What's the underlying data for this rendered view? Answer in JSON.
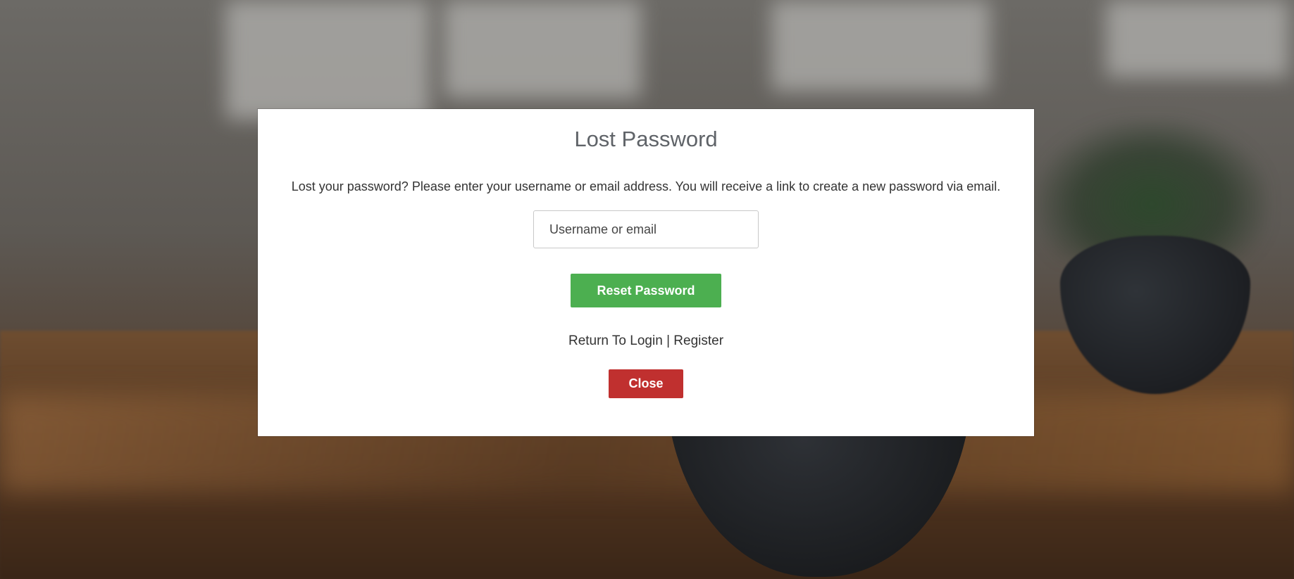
{
  "modal": {
    "title": "Lost Password",
    "description": "Lost your password? Please enter your username or email address. You will receive a link to create a new password via email.",
    "input_placeholder": "Username or email",
    "input_value": "",
    "reset_label": "Reset Password",
    "return_login_label": "Return To Login",
    "separator": "|",
    "register_label": "Register",
    "close_label": "Close"
  },
  "colors": {
    "reset_button": "#4caf50",
    "close_button": "#c0302f",
    "modal_background": "#ffffff"
  }
}
